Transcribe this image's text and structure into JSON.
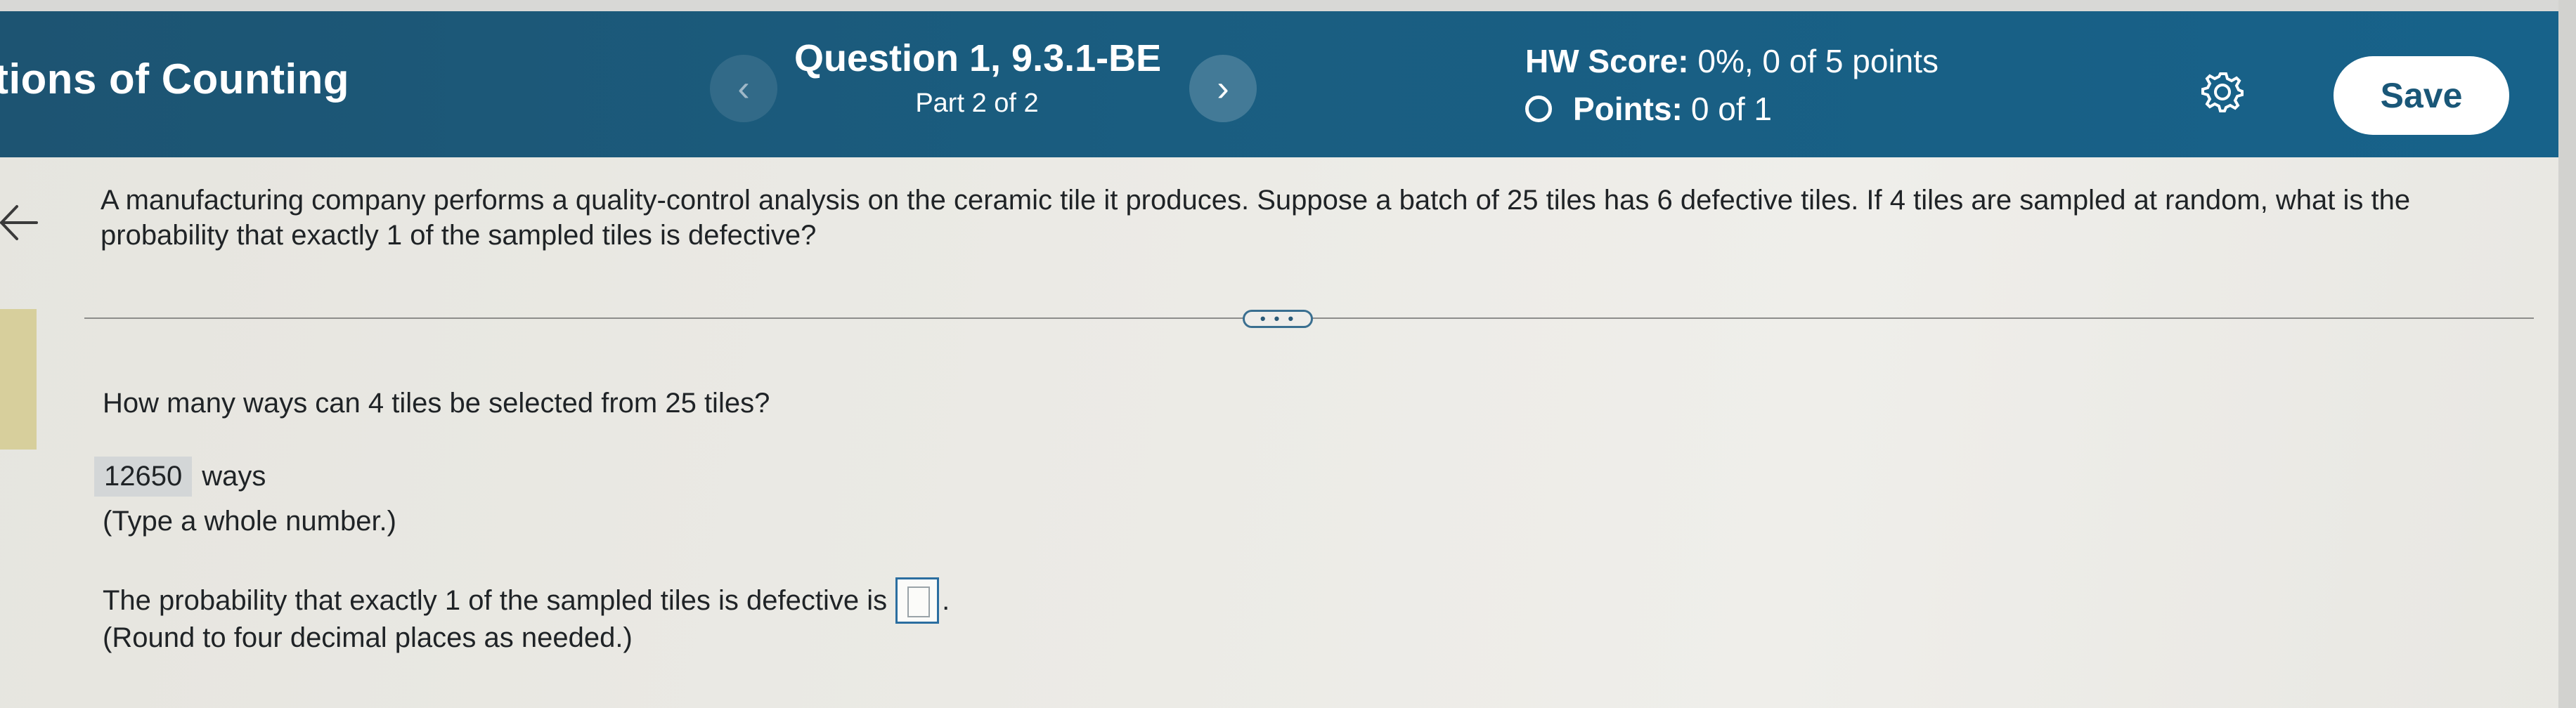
{
  "header": {
    "chapter_title": "tions of Counting",
    "question_title": "Question 1, 9.3.1-BE",
    "question_part": "Part 2 of 2",
    "hw_score_label": "HW Score:",
    "hw_score_value": "0%, 0 of 5 points",
    "points_label": "Points:",
    "points_value": "0 of 1",
    "save_label": "Save",
    "prev_icon": "chevron-left-icon",
    "next_icon": "chevron-right-icon",
    "settings_icon": "gear-icon"
  },
  "problem": {
    "text": "A manufacturing company performs a quality-control analysis on the ceramic tile it produces. Suppose a batch of 25 tiles has 6 defective tiles. If 4 tiles are sampled at random, what is the probability that exactly 1 of the sampled tiles is defective?",
    "more_label": "• • •"
  },
  "part1": {
    "question": "How many ways can 4 tiles be selected from 25 tiles?",
    "answer_value": "12650",
    "answer_unit": "ways",
    "hint": "(Type a whole number.)"
  },
  "part2": {
    "question": "The probability that exactly 1 of the sampled tiles is defective is",
    "answer_value": "",
    "suffix": ".",
    "hint": "(Round to four decimal places as needed.)"
  },
  "colors": {
    "header_bg": "#1a5d80",
    "save_text": "#1a5778",
    "page_bg": "#e9e8e3"
  }
}
